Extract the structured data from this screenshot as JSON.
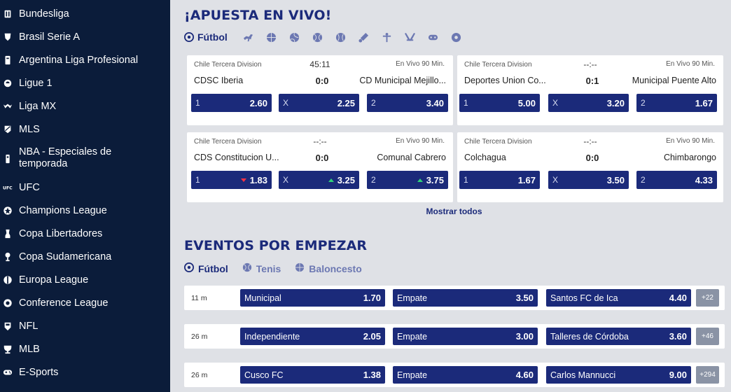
{
  "sidebar": {
    "items": [
      {
        "label": "Bundesliga",
        "icon": "bundesliga-icon"
      },
      {
        "label": "Brasil Serie A",
        "icon": "brasil-serie-a-icon"
      },
      {
        "label": "Argentina Liga Profesional",
        "icon": "argentina-liga-icon"
      },
      {
        "label": "Ligue 1",
        "icon": "ligue-1-icon"
      },
      {
        "label": "Liga MX",
        "icon": "liga-mx-icon"
      },
      {
        "label": "MLS",
        "icon": "mls-icon"
      },
      {
        "label": "NBA - Especiales de temporada",
        "icon": "nba-icon"
      },
      {
        "label": "UFC",
        "icon": "ufc-icon"
      },
      {
        "label": "Champions League",
        "icon": "champions-league-icon"
      },
      {
        "label": "Copa Libertadores",
        "icon": "copa-libertadores-icon"
      },
      {
        "label": "Copa Sudamericana",
        "icon": "copa-sudamericana-icon"
      },
      {
        "label": "Europa League",
        "icon": "europa-league-icon"
      },
      {
        "label": "Conference League",
        "icon": "conference-league-icon"
      },
      {
        "label": "NFL",
        "icon": "nfl-icon"
      },
      {
        "label": "MLB",
        "icon": "mlb-icon"
      },
      {
        "label": "E-Sports",
        "icon": "esports-icon"
      }
    ]
  },
  "live": {
    "title": "¡APUESTA EN VIVO!",
    "active_sport": "Fútbol",
    "sport_icons": [
      "horse-racing-icon",
      "basketball-icon",
      "volleyball-icon",
      "tennis-icon",
      "baseball-icon",
      "cricket-icon",
      "martial-arts-icon",
      "hockey-icon",
      "esports-icon",
      "soccer-icon"
    ],
    "matches": [
      {
        "league": "Chile Tercera Division",
        "time": "45:11",
        "status": "En Vivo 90 Min.",
        "home": "CDSC Iberia",
        "score": "0:0",
        "away": "CD Municipal Mejillo...",
        "odds": [
          {
            "label": "1",
            "value": "2.60",
            "trend": ""
          },
          {
            "label": "X",
            "value": "2.25",
            "trend": ""
          },
          {
            "label": "2",
            "value": "3.40",
            "trend": ""
          }
        ]
      },
      {
        "league": "Chile Tercera Division",
        "time": "--:--",
        "status": "En Vivo 90 Min.",
        "home": "Deportes Union Co...",
        "score": "0:1",
        "away": "Municipal Puente Alto",
        "odds": [
          {
            "label": "1",
            "value": "5.00",
            "trend": ""
          },
          {
            "label": "X",
            "value": "3.20",
            "trend": ""
          },
          {
            "label": "2",
            "value": "1.67",
            "trend": ""
          }
        ]
      },
      {
        "league": "Chile Tercera Division",
        "time": "--:--",
        "status": "En Vivo 90 Min.",
        "home": "CDS Constitucion U...",
        "score": "0:0",
        "away": "Comunal Cabrero",
        "odds": [
          {
            "label": "1",
            "value": "1.83",
            "trend": "down"
          },
          {
            "label": "X",
            "value": "3.25",
            "trend": "up"
          },
          {
            "label": "2",
            "value": "3.75",
            "trend": "up"
          }
        ]
      },
      {
        "league": "Chile Tercera Division",
        "time": "--:--",
        "status": "En Vivo 90 Min.",
        "home": "Colchagua",
        "score": "0:0",
        "away": "Chimbarongo",
        "odds": [
          {
            "label": "1",
            "value": "1.67",
            "trend": ""
          },
          {
            "label": "X",
            "value": "3.50",
            "trend": ""
          },
          {
            "label": "2",
            "value": "4.33",
            "trend": ""
          }
        ]
      }
    ],
    "show_all": "Mostrar todos"
  },
  "upcoming": {
    "title": "EVENTOS POR EMPEZAR",
    "tabs": [
      {
        "label": "Fútbol",
        "icon": "soccer-icon",
        "active": true
      },
      {
        "label": "Tenis",
        "icon": "tennis-icon",
        "active": false
      },
      {
        "label": "Baloncesto",
        "icon": "basketball-icon",
        "active": false
      }
    ],
    "events": [
      {
        "time": "11 m",
        "home": "Municipal",
        "home_odd": "1.70",
        "draw": "Empate",
        "draw_odd": "3.50",
        "away": "Santos FC de Ica",
        "away_odd": "4.40",
        "more": "+22"
      },
      {
        "time": "26 m",
        "home": "Independiente",
        "home_odd": "2.05",
        "draw": "Empate",
        "draw_odd": "3.00",
        "away": "Talleres de Córdoba",
        "away_odd": "3.60",
        "more": "+46"
      },
      {
        "time": "26 m",
        "home": "Cusco FC",
        "home_odd": "1.38",
        "draw": "Empate",
        "draw_odd": "4.60",
        "away": "Carlos Mannucci",
        "away_odd": "9.00",
        "more": "+294"
      }
    ]
  },
  "colors": {
    "sidebar_bg": "#0b1c3a",
    "page_bg": "#dfe1e6",
    "brand_blue": "#1b2a7a",
    "odd_down": "#ff3344",
    "odd_up": "#2fd27a"
  }
}
